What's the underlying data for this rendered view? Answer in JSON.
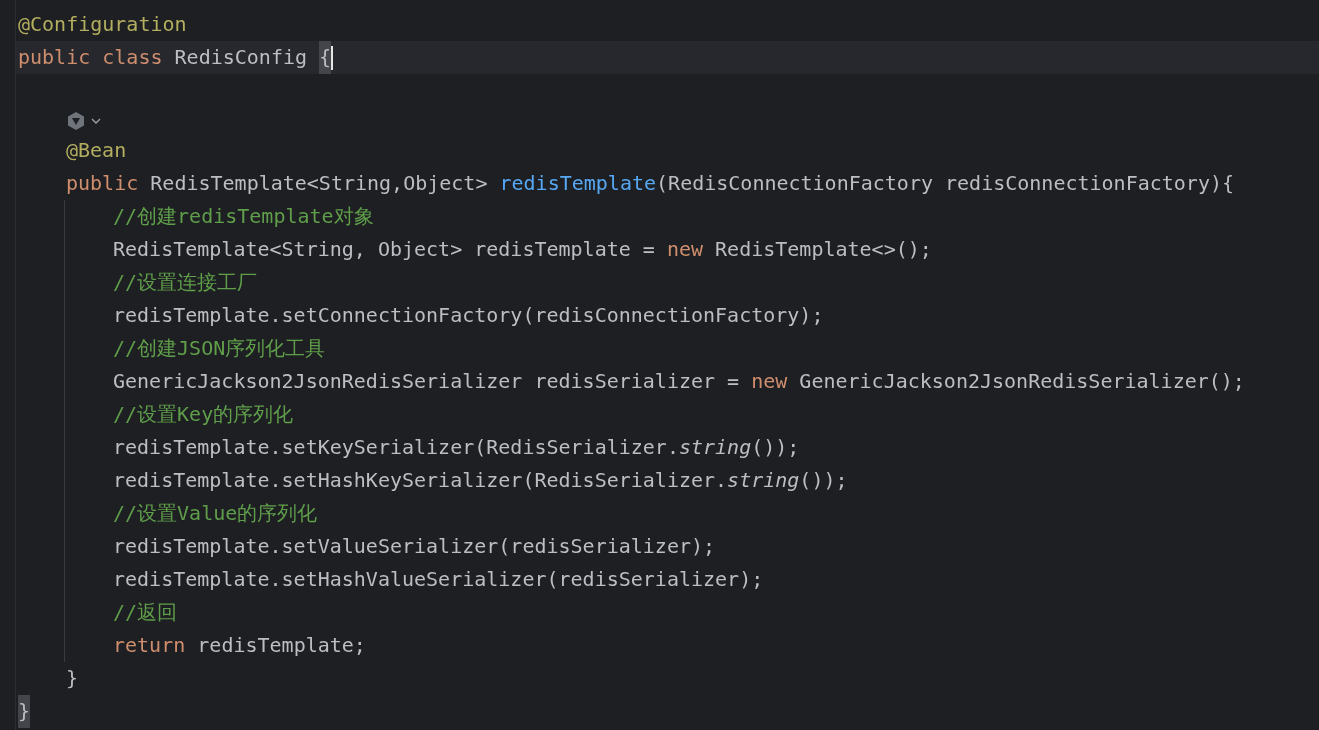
{
  "editor": {
    "lines": [
      {
        "current": false,
        "tokens": [
          {
            "kind": "annotation",
            "text": "@Configuration"
          }
        ]
      },
      {
        "current": true,
        "tokens": [
          {
            "kind": "keyword",
            "text": "public class "
          },
          {
            "kind": "plain",
            "text": "RedisConfig "
          },
          {
            "kind": "brace-match",
            "text": "{"
          },
          {
            "kind": "caret"
          }
        ],
        "children": [
          {
            "current": false
          },
          {
            "current": false,
            "kind": "inlay"
          },
          {
            "current": false,
            "tokens": [
              {
                "kind": "annotation",
                "text": "@Bean"
              }
            ]
          },
          {
            "current": false,
            "tokens": [
              {
                "kind": "keyword",
                "text": "public "
              },
              {
                "kind": "plain",
                "text": "RedisTemplate<String,Object> "
              },
              {
                "kind": "method",
                "text": "redisTemplate"
              },
              {
                "kind": "plain",
                "text": "(RedisConnectionFactory redisConnectionFactory){"
              }
            ],
            "children": [
              {
                "current": false,
                "tokens": [
                  {
                    "kind": "comment",
                    "text": "//创建redisTemplate对象"
                  }
                ]
              },
              {
                "current": false,
                "tokens": [
                  {
                    "kind": "plain",
                    "text": "RedisTemplate<String, Object> redisTemplate = "
                  },
                  {
                    "kind": "keyword",
                    "text": "new "
                  },
                  {
                    "kind": "plain",
                    "text": "RedisTemplate<>();"
                  }
                ]
              },
              {
                "current": false,
                "tokens": [
                  {
                    "kind": "comment",
                    "text": "//设置连接工厂"
                  }
                ]
              },
              {
                "current": false,
                "tokens": [
                  {
                    "kind": "plain",
                    "text": "redisTemplate.setConnectionFactory(redisConnectionFactory);"
                  }
                ]
              },
              {
                "current": false,
                "tokens": [
                  {
                    "kind": "comment",
                    "text": "//创建JSON序列化工具"
                  }
                ]
              },
              {
                "current": false,
                "tokens": [
                  {
                    "kind": "plain",
                    "text": "GenericJackson2JsonRedisSerializer redisSerializer = "
                  },
                  {
                    "kind": "keyword",
                    "text": "new "
                  },
                  {
                    "kind": "plain",
                    "text": "GenericJackson2JsonRedisSerializer();"
                  }
                ]
              },
              {
                "current": false,
                "tokens": [
                  {
                    "kind": "comment",
                    "text": "//设置Key的序列化"
                  }
                ]
              },
              {
                "current": false,
                "tokens": [
                  {
                    "kind": "plain",
                    "text": "redisTemplate.setKeySerializer(RedisSerializer."
                  },
                  {
                    "kind": "static",
                    "text": "string"
                  },
                  {
                    "kind": "plain",
                    "text": "());"
                  }
                ]
              },
              {
                "current": false,
                "tokens": [
                  {
                    "kind": "plain",
                    "text": "redisTemplate.setHashKeySerializer(RedisSerializer."
                  },
                  {
                    "kind": "static",
                    "text": "string"
                  },
                  {
                    "kind": "plain",
                    "text": "());"
                  }
                ]
              },
              {
                "current": false,
                "tokens": [
                  {
                    "kind": "comment",
                    "text": "//设置Value的序列化"
                  }
                ]
              },
              {
                "current": false,
                "tokens": [
                  {
                    "kind": "plain",
                    "text": "redisTemplate.setValueSerializer(redisSerializer);"
                  }
                ]
              },
              {
                "current": false,
                "tokens": [
                  {
                    "kind": "plain",
                    "text": "redisTemplate.setHashValueSerializer(redisSerializer);"
                  }
                ]
              },
              {
                "current": false,
                "tokens": [
                  {
                    "kind": "comment",
                    "text": "//返回"
                  }
                ]
              },
              {
                "current": false,
                "tokens": [
                  {
                    "kind": "keyword",
                    "text": "return "
                  },
                  {
                    "kind": "plain",
                    "text": "redisTemplate;"
                  }
                ]
              }
            ]
          },
          {
            "current": false,
            "tokens": [
              {
                "kind": "plain",
                "text": "}"
              }
            ]
          }
        ]
      },
      {
        "current": false,
        "tokens": [
          {
            "kind": "brace-match",
            "text": "}"
          }
        ]
      }
    ]
  }
}
